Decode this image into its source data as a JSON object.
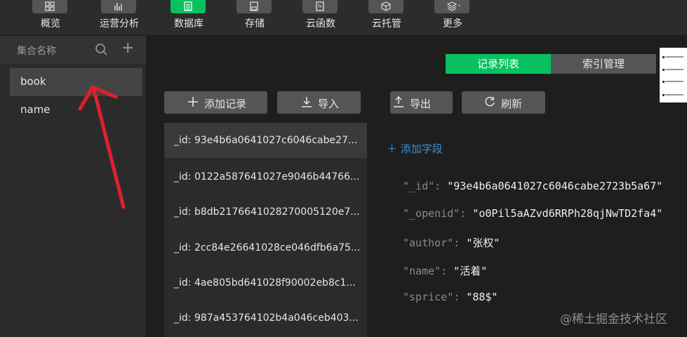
{
  "toolbar": {
    "items": [
      {
        "label": "概览",
        "icon": "grid-icon"
      },
      {
        "label": "运营分析",
        "icon": "bar-chart-icon"
      },
      {
        "label": "数据库",
        "icon": "database-icon"
      },
      {
        "label": "存储",
        "icon": "save-icon"
      },
      {
        "label": "云函数",
        "icon": "function-icon"
      },
      {
        "label": "云托管",
        "icon": "cube-icon"
      },
      {
        "label": "更多",
        "icon": "layers-icon"
      }
    ],
    "active": "数据库"
  },
  "sidebar": {
    "title": "集合名称",
    "collections": [
      "book",
      "name"
    ],
    "selected": "book"
  },
  "tabs": [
    "记录列表",
    "索引管理"
  ],
  "actions": [
    "添加记录",
    "导入",
    "导出",
    "刷新"
  ],
  "records": [
    "_id: 93e4b6a0641027c6046cabe27...",
    "_id: 0122a587641027e9046b44766...",
    "_id: b8db2176641028270005120e7...",
    "_id: 2cc84e26641028ce046dfb6a75...",
    "_id: 4ae805bd641028f90002eb8c1...",
    "_id: 987a453764102b4a046ceb403..."
  ],
  "detail": {
    "add_field": "添加字段",
    "fields": [
      {
        "key": "\"_id\"",
        "value": "\"93e4b6a0641027c6046cabe2723b5a67\""
      },
      {
        "key": "\"_openid\"",
        "value": "\"o0Pil5aAZvd6RRPh28qjNwTD2fa4\""
      },
      {
        "key": "\"author\"",
        "value": "\"张权\""
      },
      {
        "key": "\"name\"",
        "value": "\"活着\""
      },
      {
        "key": "\"sprice\"",
        "value": "\"88$\""
      }
    ]
  },
  "watermark": "@稀土掘金技术社区",
  "colors": {
    "accent": "#07c160",
    "link": "#3b8fd8",
    "annotation": "#e0202a"
  }
}
